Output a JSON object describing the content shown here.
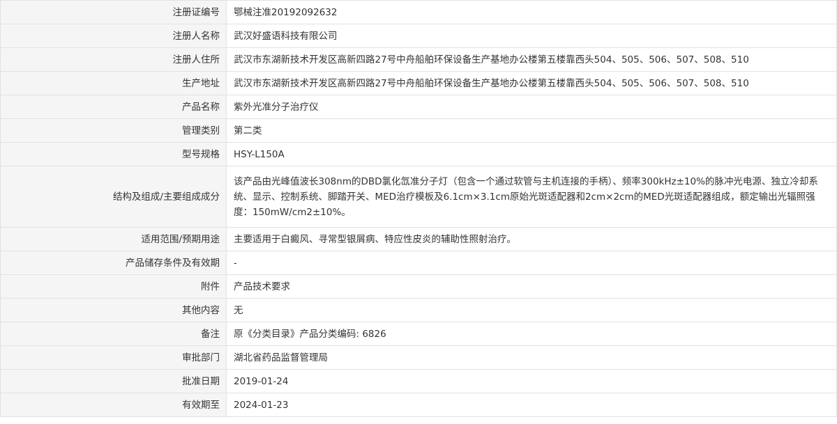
{
  "rows": [
    {
      "label": "注册证编号",
      "value": "鄂械注准20192092632"
    },
    {
      "label": "注册人名称",
      "value": "武汉好盛语科技有限公司"
    },
    {
      "label": "注册人住所",
      "value": "武汉市东湖新技术开发区高新四路27号中舟船舶环保设备生产基地办公楼第五楼靠西头504、505、506、507、508、510"
    },
    {
      "label": "生产地址",
      "value": "武汉市东湖新技术开发区高新四路27号中舟船舶环保设备生产基地办公楼第五楼靠西头504、505、506、507、508、510"
    },
    {
      "label": "产品名称",
      "value": "紫外光准分子治疗仪"
    },
    {
      "label": "管理类别",
      "value": "第二类"
    },
    {
      "label": "型号规格",
      "value": "HSY-L150A"
    },
    {
      "label": "结构及组成/主要组成成分",
      "value": "该产品由光峰值波长308nm的DBD氯化氙准分子灯（包含一个通过软管与主机连接的手柄）、频率300kHz±10%的脉冲光电源、独立冷却系统、显示、控制系统、脚踏开关、MED治疗模板及6.1cm×3.1cm原始光斑适配器和2cm×2cm的MED光斑适配器组成，额定输出光辐照强度：150mW/cm2±10%。"
    },
    {
      "label": "适用范围/预期用途",
      "value": "主要适用于白癜风、寻常型银屑病、特应性皮炎的辅助性照射治疗。"
    },
    {
      "label": "产品储存条件及有效期",
      "value": "-"
    },
    {
      "label": "附件",
      "value": "产品技术要求"
    },
    {
      "label": "其他内容",
      "value": "无"
    },
    {
      "label": "备注",
      "value": "原《分类目录》产品分类编码: 6826"
    },
    {
      "label": "审批部门",
      "value": "湖北省药品监督管理局"
    },
    {
      "label": "批准日期",
      "value": "2019-01-24"
    },
    {
      "label": "有效期至",
      "value": "2024-01-23"
    }
  ],
  "colors": {
    "label_bg": "#f5f5f5",
    "value_bg": "#ffffff",
    "border": "#e2e2e2",
    "text": "#333333"
  }
}
